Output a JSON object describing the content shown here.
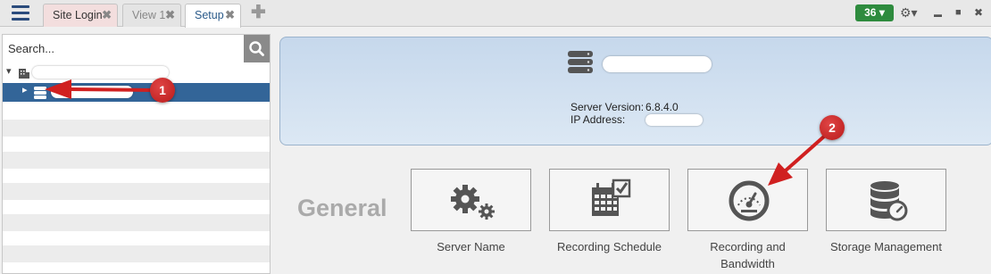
{
  "tabs": [
    {
      "label": "Site Login",
      "close": "✖"
    },
    {
      "label": "View 1",
      "close": "✖"
    },
    {
      "label": "Setup",
      "close": "✖"
    }
  ],
  "tab_add": "✚",
  "notifications": {
    "count": "36",
    "arrow": "▾"
  },
  "toolbar_icons": [
    "gear-icon",
    "minimize-icon",
    "restore-icon",
    "close-icon"
  ],
  "toolbar": {
    "gear": "⚙▾",
    "minimize": "▬",
    "restore": "■",
    "close": "✖"
  },
  "sidebar": {
    "search_placeholder": "Search...",
    "tree_expand": "▾",
    "tree_collapse": "▸"
  },
  "server": {
    "version_label": "Server Version:",
    "version_value": "6.8.4.0",
    "ip_label": "IP Address:"
  },
  "section_title": "General",
  "cards": [
    {
      "label": "Server Name",
      "icon": "gears-icon"
    },
    {
      "label": "Recording Schedule",
      "icon": "calendar-check-icon"
    },
    {
      "label": "Recording and Bandwidth",
      "icon": "gauge-icon"
    },
    {
      "label": "Storage Management",
      "icon": "database-gauge-icon"
    }
  ],
  "callouts": [
    "1",
    "2"
  ],
  "colors": {
    "accent": "#336598",
    "badge": "#2e8b3e",
    "callout": "#c62828"
  }
}
